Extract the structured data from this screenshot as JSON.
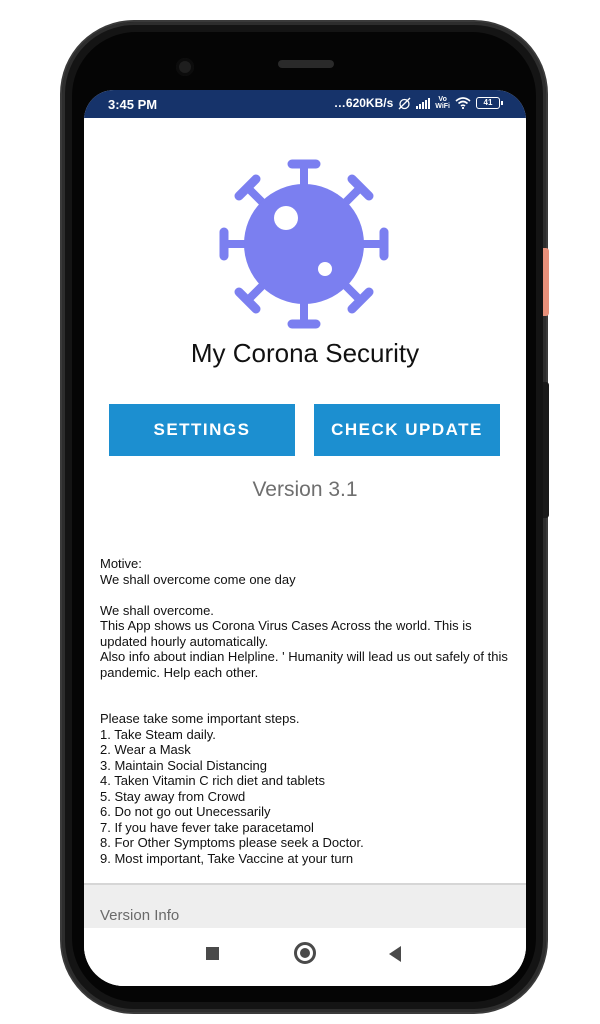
{
  "statusbar": {
    "time": "3:45 PM",
    "speed": "…620KB/s",
    "vowifi_top": "Vo",
    "vowifi_bottom": "WiFi",
    "battery": "41"
  },
  "app": {
    "title": "My Corona Security",
    "logo_icon": "virus-icon",
    "accent_color": "#7b7ff0"
  },
  "buttons": {
    "settings_label": "SETTINGS",
    "check_update_label": "CHECK UPDATE",
    "color": "#1c8fd0"
  },
  "version_label": "Version 3.1",
  "motive_text": "Motive:\nWe shall overcome come one day\n\n We shall overcome.\nThis App shows us Corona Virus Cases Across the world. This is updated hourly automatically.\nAlso info about indian Helpline. ' Humanity will lead us out safely of this pandemic. Help each other.\n\n\nPlease take some important steps.\n1. Take Steam daily.\n2. Wear a Mask\n3. Maintain Social Distancing\n4. Taken Vitamin C rich diet and tablets\n5. Stay away from Crowd\n6. Do not go out Unecessarily\n7. If you have fever take paracetamol\n8. For Other Symptoms please seek a Doctor.\n9. Most important, Take Vaccine at your turn",
  "version_info_label": "Version Info",
  "navbar": {
    "recents_icon": "square-icon",
    "home_icon": "circle-icon",
    "back_icon": "triangle-back-icon"
  }
}
